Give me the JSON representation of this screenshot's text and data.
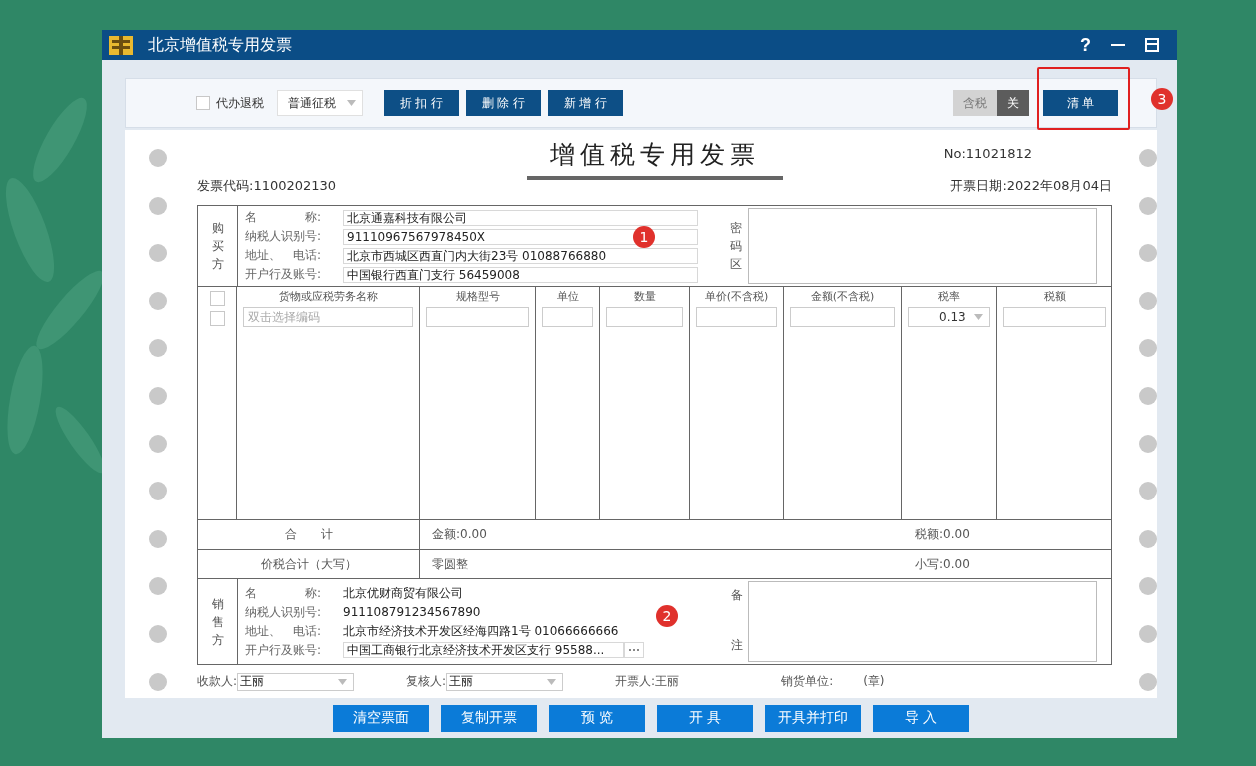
{
  "window": {
    "title": "北京增值税专用发票",
    "help": "?"
  },
  "toolbar": {
    "withhold": {
      "label": "代办退税",
      "checked": false
    },
    "levy_type": "普通征税",
    "buttons": [
      "折 扣 行",
      "删 除 行",
      "新 增 行"
    ],
    "tax_toggle": {
      "label": "含税",
      "value": "关",
      "on": false
    },
    "list_button": {
      "label": "清 单",
      "highlighted": true,
      "annotation": "3"
    }
  },
  "invoice": {
    "title": "增值税专用发票",
    "number": "No:11021812",
    "code": "发票代码:1100202130",
    "date": "开票日期:2022年08月04日",
    "buyer": {
      "heading": "购买方",
      "annotation": "1",
      "cipher_label": "密码区",
      "fields": [
        {
          "label": "名　　　　称:",
          "value": "北京通嘉科技有限公司",
          "kind": "input"
        },
        {
          "label": "纳税人识别号:",
          "value": "91110967567978450X",
          "kind": "input"
        },
        {
          "label": "地址、　电话:",
          "value": "北京市西城区西直门内大街23号 01088766880",
          "kind": "input"
        },
        {
          "label": "开户行及账号:",
          "value": "中国银行西直门支行 56459008",
          "kind": "input"
        }
      ]
    },
    "items": {
      "checkboxes": [
        {
          "checked": false
        },
        {
          "checked": false
        }
      ],
      "columns": [
        "货物或应税劳务名称",
        "规格型号",
        "单位",
        "数量",
        "单价(不含税)",
        "金额(不含税)",
        "税率",
        "税额"
      ],
      "name_placeholder": "双击选择编码",
      "tax_rate": "0.13"
    },
    "total": {
      "label": "合　　计",
      "amount": "金额:0.00",
      "tax": "税额:0.00"
    },
    "grand_total": {
      "label": "价税合计（大写）",
      "in_words": "零圆整",
      "in_figures": "小写:0.00"
    },
    "seller": {
      "heading": "销售方",
      "annotation": "2",
      "remarks_label": [
        "备",
        "注"
      ],
      "fields": [
        {
          "label": "名　　　　称:",
          "value": "北京优财商贸有限公司",
          "kind": "text"
        },
        {
          "label": "纳税人识别号:",
          "value": "911108791234567890",
          "kind": "text"
        },
        {
          "label": "地址、　电话:",
          "value": "北京市经济技术开发区经海四路1号 01066666666",
          "kind": "text"
        },
        {
          "label": "开户行及账号:",
          "value": "中国工商银行北京经济技术开发区支行 95588...",
          "kind": "browse"
        }
      ]
    },
    "footer": {
      "payee": {
        "label": "收款人:",
        "value": "王丽"
      },
      "reviewer": {
        "label": "复核人:",
        "value": "王丽"
      },
      "issuer": "开票人:王丽",
      "seller_unit": "销货单位:",
      "seal": "(章)"
    }
  },
  "actions": [
    "清空票面",
    "复制开票",
    "预 览",
    "开 具",
    "开具并打印",
    "导 入"
  ]
}
